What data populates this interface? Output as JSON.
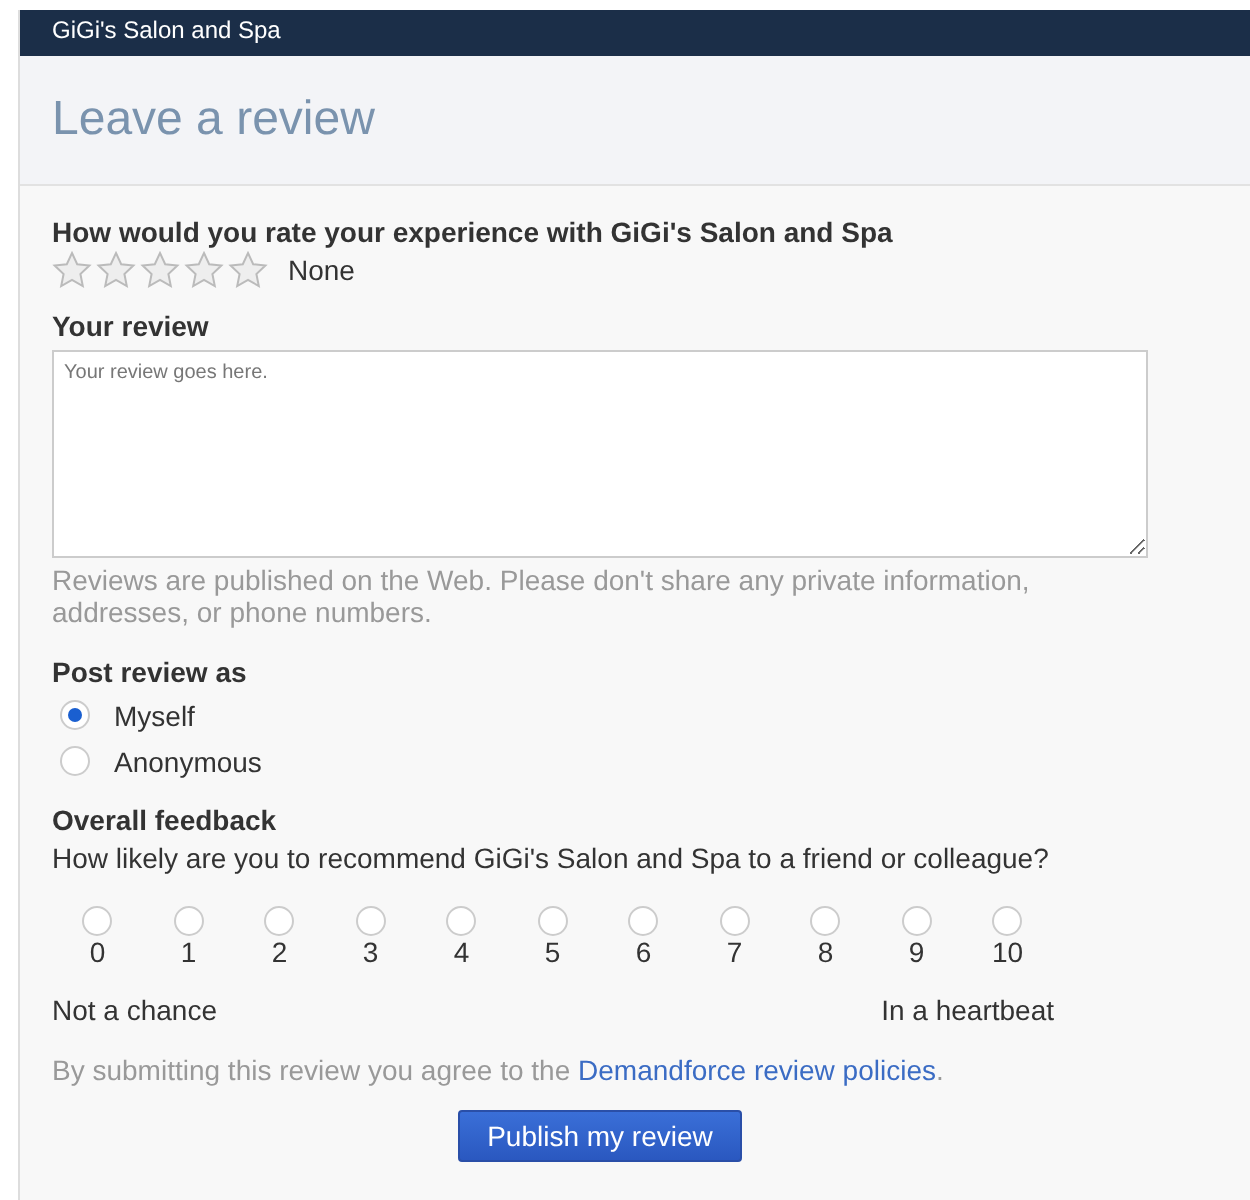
{
  "header": {
    "business_name": "GiGi's Salon and Spa"
  },
  "title": "Leave a review",
  "rating": {
    "question": "How would you rate your experience with GiGi's Salon and Spa",
    "stars": 0,
    "label": "None"
  },
  "review": {
    "label": "Your review",
    "placeholder": "Your review goes here.",
    "hint": "Reviews are published on the Web. Please don't share any private information, addresses, or phone numbers."
  },
  "post_as": {
    "label": "Post review as",
    "options": [
      {
        "label": "Myself",
        "selected": true
      },
      {
        "label": "Anonymous",
        "selected": false
      }
    ]
  },
  "feedback": {
    "label": "Overall feedback",
    "question": "How likely are you to recommend GiGi's Salon and Spa to a friend or colleague?",
    "options": [
      {
        "label": "0",
        "selected": false
      },
      {
        "label": "1",
        "selected": false
      },
      {
        "label": "2",
        "selected": false
      },
      {
        "label": "3",
        "selected": false
      },
      {
        "label": "4",
        "selected": false
      },
      {
        "label": "5",
        "selected": false
      },
      {
        "label": "6",
        "selected": false
      },
      {
        "label": "7",
        "selected": false
      },
      {
        "label": "8",
        "selected": false
      },
      {
        "label": "9",
        "selected": false
      },
      {
        "label": "10",
        "selected": false
      }
    ],
    "low_label": "Not a chance",
    "high_label": "In a heartbeat"
  },
  "policy": {
    "before": "By submitting this review you agree to the ",
    "link": "Demandforce review policies",
    "after": "."
  },
  "submit_button": "Publish my review"
}
